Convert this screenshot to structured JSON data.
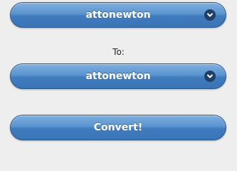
{
  "from": {
    "selected_value": "attonewton",
    "icon": "chevron-down-icon"
  },
  "to_label": "To:",
  "to": {
    "selected_value": "attonewton",
    "icon": "chevron-down-icon"
  },
  "convert_button_label": "Convert!",
  "colors": {
    "page_background": "#eeeeee",
    "button_blue": "#4a86c6",
    "button_border": "#2d5a8a",
    "chevron_bg": "#1f3f66",
    "text_white": "#ffffff",
    "label_text": "#222222"
  }
}
